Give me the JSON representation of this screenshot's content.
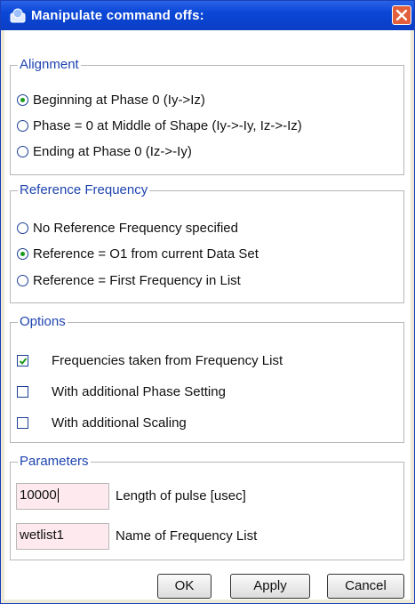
{
  "window": {
    "title": "Manipulate command offs:"
  },
  "alignment": {
    "legend": "Alignment",
    "options": [
      {
        "label": "Beginning at Phase 0 (Iy->Iz)",
        "selected": true
      },
      {
        "label": "Phase = 0 at Middle of Shape (Iy->-Iy, Iz->-Iz)",
        "selected": false
      },
      {
        "label": "Ending at Phase 0 (Iz->-Iy)",
        "selected": false
      }
    ]
  },
  "reference": {
    "legend": "Reference Frequency",
    "options": [
      {
        "label": "No Reference Frequency specified",
        "selected": false
      },
      {
        "label": "Reference = O1 from current Data Set",
        "selected": true
      },
      {
        "label": "Reference = First Frequency in List",
        "selected": false
      }
    ]
  },
  "options": {
    "legend": "Options",
    "checks": [
      {
        "label": "Frequencies taken from Frequency List",
        "checked": true
      },
      {
        "label": "With additional Phase Setting",
        "checked": false
      },
      {
        "label": "With additional Scaling",
        "checked": false
      }
    ]
  },
  "parameters": {
    "legend": "Parameters",
    "fields": [
      {
        "value": "10000",
        "label": "Length of pulse [usec]"
      },
      {
        "value": "wetlist1",
        "label": "Name of Frequency List"
      }
    ]
  },
  "buttons": {
    "ok": "OK",
    "apply": "Apply",
    "cancel": "Cancel"
  },
  "colors": {
    "title_bar": "#0a46d6",
    "legend_text": "#1e44b0",
    "input_bg": "#fde9ee",
    "radio_dot": "#1a9a1a"
  }
}
